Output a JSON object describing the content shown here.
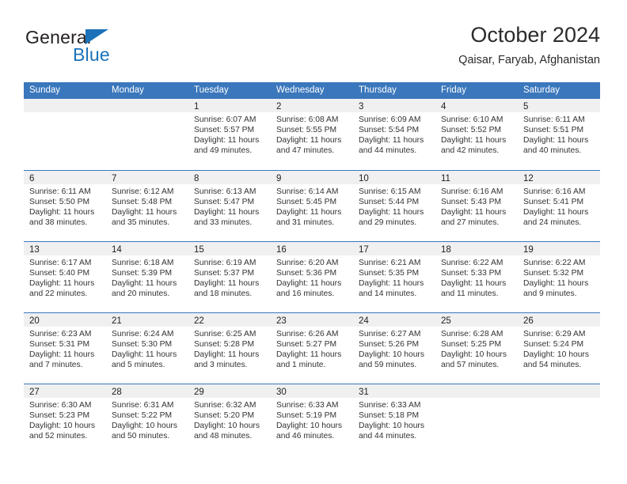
{
  "brand": {
    "name_top": "General",
    "name_bottom": "Blue",
    "colors": {
      "blue": "#1c72b8",
      "dark": "#231f20"
    }
  },
  "header": {
    "title": "October 2024",
    "subtitle": "Qaisar, Faryab, Afghanistan"
  },
  "theme": {
    "header_blue": "#3a77bc",
    "day_band_gray": "#f0f0f0",
    "text": "#222222"
  },
  "calendar": {
    "weekdays": [
      "Sunday",
      "Monday",
      "Tuesday",
      "Wednesday",
      "Thursday",
      "Friday",
      "Saturday"
    ],
    "weeks": [
      [
        {
          "day": ""
        },
        {
          "day": ""
        },
        {
          "day": "1",
          "sunrise": "Sunrise: 6:07 AM",
          "sunset": "Sunset: 5:57 PM",
          "daylight": "Daylight: 11 hours and 49 minutes."
        },
        {
          "day": "2",
          "sunrise": "Sunrise: 6:08 AM",
          "sunset": "Sunset: 5:55 PM",
          "daylight": "Daylight: 11 hours and 47 minutes."
        },
        {
          "day": "3",
          "sunrise": "Sunrise: 6:09 AM",
          "sunset": "Sunset: 5:54 PM",
          "daylight": "Daylight: 11 hours and 44 minutes."
        },
        {
          "day": "4",
          "sunrise": "Sunrise: 6:10 AM",
          "sunset": "Sunset: 5:52 PM",
          "daylight": "Daylight: 11 hours and 42 minutes."
        },
        {
          "day": "5",
          "sunrise": "Sunrise: 6:11 AM",
          "sunset": "Sunset: 5:51 PM",
          "daylight": "Daylight: 11 hours and 40 minutes."
        }
      ],
      [
        {
          "day": "6",
          "sunrise": "Sunrise: 6:11 AM",
          "sunset": "Sunset: 5:50 PM",
          "daylight": "Daylight: 11 hours and 38 minutes."
        },
        {
          "day": "7",
          "sunrise": "Sunrise: 6:12 AM",
          "sunset": "Sunset: 5:48 PM",
          "daylight": "Daylight: 11 hours and 35 minutes."
        },
        {
          "day": "8",
          "sunrise": "Sunrise: 6:13 AM",
          "sunset": "Sunset: 5:47 PM",
          "daylight": "Daylight: 11 hours and 33 minutes."
        },
        {
          "day": "9",
          "sunrise": "Sunrise: 6:14 AM",
          "sunset": "Sunset: 5:45 PM",
          "daylight": "Daylight: 11 hours and 31 minutes."
        },
        {
          "day": "10",
          "sunrise": "Sunrise: 6:15 AM",
          "sunset": "Sunset: 5:44 PM",
          "daylight": "Daylight: 11 hours and 29 minutes."
        },
        {
          "day": "11",
          "sunrise": "Sunrise: 6:16 AM",
          "sunset": "Sunset: 5:43 PM",
          "daylight": "Daylight: 11 hours and 27 minutes."
        },
        {
          "day": "12",
          "sunrise": "Sunrise: 6:16 AM",
          "sunset": "Sunset: 5:41 PM",
          "daylight": "Daylight: 11 hours and 24 minutes."
        }
      ],
      [
        {
          "day": "13",
          "sunrise": "Sunrise: 6:17 AM",
          "sunset": "Sunset: 5:40 PM",
          "daylight": "Daylight: 11 hours and 22 minutes."
        },
        {
          "day": "14",
          "sunrise": "Sunrise: 6:18 AM",
          "sunset": "Sunset: 5:39 PM",
          "daylight": "Daylight: 11 hours and 20 minutes."
        },
        {
          "day": "15",
          "sunrise": "Sunrise: 6:19 AM",
          "sunset": "Sunset: 5:37 PM",
          "daylight": "Daylight: 11 hours and 18 minutes."
        },
        {
          "day": "16",
          "sunrise": "Sunrise: 6:20 AM",
          "sunset": "Sunset: 5:36 PM",
          "daylight": "Daylight: 11 hours and 16 minutes."
        },
        {
          "day": "17",
          "sunrise": "Sunrise: 6:21 AM",
          "sunset": "Sunset: 5:35 PM",
          "daylight": "Daylight: 11 hours and 14 minutes."
        },
        {
          "day": "18",
          "sunrise": "Sunrise: 6:22 AM",
          "sunset": "Sunset: 5:33 PM",
          "daylight": "Daylight: 11 hours and 11 minutes."
        },
        {
          "day": "19",
          "sunrise": "Sunrise: 6:22 AM",
          "sunset": "Sunset: 5:32 PM",
          "daylight": "Daylight: 11 hours and 9 minutes."
        }
      ],
      [
        {
          "day": "20",
          "sunrise": "Sunrise: 6:23 AM",
          "sunset": "Sunset: 5:31 PM",
          "daylight": "Daylight: 11 hours and 7 minutes."
        },
        {
          "day": "21",
          "sunrise": "Sunrise: 6:24 AM",
          "sunset": "Sunset: 5:30 PM",
          "daylight": "Daylight: 11 hours and 5 minutes."
        },
        {
          "day": "22",
          "sunrise": "Sunrise: 6:25 AM",
          "sunset": "Sunset: 5:28 PM",
          "daylight": "Daylight: 11 hours and 3 minutes."
        },
        {
          "day": "23",
          "sunrise": "Sunrise: 6:26 AM",
          "sunset": "Sunset: 5:27 PM",
          "daylight": "Daylight: 11 hours and 1 minute."
        },
        {
          "day": "24",
          "sunrise": "Sunrise: 6:27 AM",
          "sunset": "Sunset: 5:26 PM",
          "daylight": "Daylight: 10 hours and 59 minutes."
        },
        {
          "day": "25",
          "sunrise": "Sunrise: 6:28 AM",
          "sunset": "Sunset: 5:25 PM",
          "daylight": "Daylight: 10 hours and 57 minutes."
        },
        {
          "day": "26",
          "sunrise": "Sunrise: 6:29 AM",
          "sunset": "Sunset: 5:24 PM",
          "daylight": "Daylight: 10 hours and 54 minutes."
        }
      ],
      [
        {
          "day": "27",
          "sunrise": "Sunrise: 6:30 AM",
          "sunset": "Sunset: 5:23 PM",
          "daylight": "Daylight: 10 hours and 52 minutes."
        },
        {
          "day": "28",
          "sunrise": "Sunrise: 6:31 AM",
          "sunset": "Sunset: 5:22 PM",
          "daylight": "Daylight: 10 hours and 50 minutes."
        },
        {
          "day": "29",
          "sunrise": "Sunrise: 6:32 AM",
          "sunset": "Sunset: 5:20 PM",
          "daylight": "Daylight: 10 hours and 48 minutes."
        },
        {
          "day": "30",
          "sunrise": "Sunrise: 6:33 AM",
          "sunset": "Sunset: 5:19 PM",
          "daylight": "Daylight: 10 hours and 46 minutes."
        },
        {
          "day": "31",
          "sunrise": "Sunrise: 6:33 AM",
          "sunset": "Sunset: 5:18 PM",
          "daylight": "Daylight: 10 hours and 44 minutes."
        },
        {
          "day": ""
        },
        {
          "day": ""
        }
      ]
    ]
  }
}
